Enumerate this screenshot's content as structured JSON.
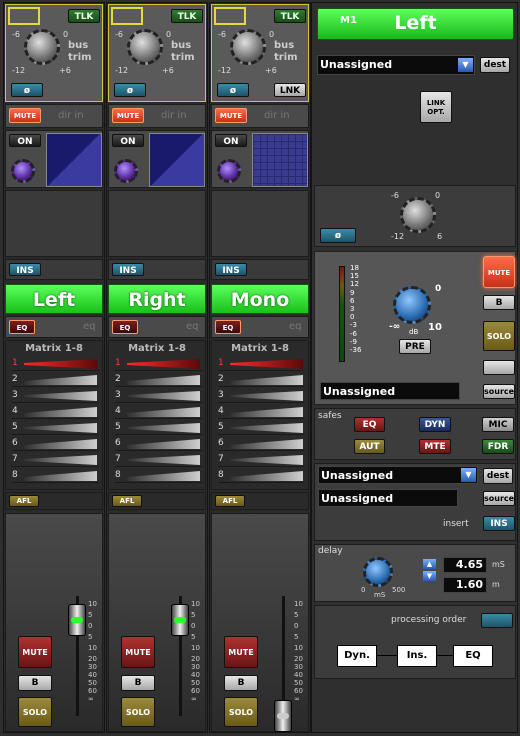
{
  "strips": [
    {
      "name": "Left",
      "trim_left": "-6",
      "trim_right": "0",
      "trim_min": "-12",
      "trim_max": "+6",
      "trim_label_1": "bus",
      "trim_label_2": "trim",
      "tlk": "TLK",
      "phase": "ø",
      "mute": "MUTE",
      "dirin": "dir in",
      "on": "ON",
      "ins": "INS",
      "eq": "EQ",
      "eq2": "eq",
      "matrix": "Matrix 1-8",
      "afl": "AFL",
      "fmute": "MUTE",
      "fb": "B",
      "fsolo": "SOLO",
      "lnk": ""
    },
    {
      "name": "Right",
      "trim_left": "-6",
      "trim_right": "0",
      "trim_min": "-12",
      "trim_max": "+6",
      "trim_label_1": "bus",
      "trim_label_2": "trim",
      "tlk": "TLK",
      "phase": "ø",
      "mute": "MUTE",
      "dirin": "dir in",
      "on": "ON",
      "ins": "INS",
      "eq": "EQ",
      "eq2": "eq",
      "matrix": "Matrix 1-8",
      "afl": "AFL",
      "fmute": "MUTE",
      "fb": "B",
      "fsolo": "SOLO",
      "lnk": ""
    },
    {
      "name": "Mono",
      "trim_left": "-6",
      "trim_right": "0",
      "trim_min": "-12",
      "trim_max": "+6",
      "trim_label_1": "bus",
      "trim_label_2": "trim",
      "tlk": "TLK",
      "phase": "ø",
      "mute": "MUTE",
      "dirin": "dir in",
      "on": "ON",
      "ins": "INS",
      "eq": "EQ",
      "eq2": "eq",
      "matrix": "Matrix 1-8",
      "afl": "AFL",
      "fmute": "MUTE",
      "fb": "B",
      "fsolo": "SOLO",
      "lnk": "LNK"
    }
  ],
  "matrix_rows": [
    "1",
    "2",
    "3",
    "4",
    "5",
    "6",
    "7",
    "8"
  ],
  "fader_scale": [
    "10",
    "5",
    "0",
    "5",
    "10",
    "20",
    "30",
    "40",
    "50",
    "60",
    "∞"
  ],
  "right": {
    "m1": "M1",
    "title": "Left",
    "dest1": "Unassigned",
    "dest_btn": "dest",
    "link_opt": "LINK OPT.",
    "knob_l": "-6",
    "knob_r": "0",
    "knob_min": "-12",
    "knob_max": "6",
    "phase": "ø",
    "meter_scale": [
      "18",
      "15",
      "12",
      "9",
      "6",
      "3",
      "0",
      "-3",
      "-6",
      "-9",
      "-36"
    ],
    "gain_top": "0",
    "gain_min": "-∞",
    "gain_max": "10",
    "gain_unit": "dB",
    "pre": "PRE",
    "mute": "MUTE",
    "b": "B",
    "solo": "SOLO",
    "source1": "Unassigned",
    "source_btn": "source",
    "safes": "safes",
    "eq": "EQ",
    "dyn": "DYN",
    "mic": "MIC",
    "aut": "AUT",
    "mte": "MTE",
    "fdr": "FDR",
    "insert1": "Unassigned",
    "insert2": "Unassigned",
    "dest2": "dest",
    "source2": "source",
    "insert_lbl": "insert",
    "ins": "INS",
    "delay": "delay",
    "delay_ms": "4.65",
    "delay_ms_unit": "mS",
    "delay_m": "1.60",
    "delay_m_unit": "m",
    "d0": "0",
    "d500": "500",
    "dms": "mS",
    "proc_order": "processing order",
    "order": [
      "Dyn.",
      "Ins.",
      "EQ"
    ]
  }
}
